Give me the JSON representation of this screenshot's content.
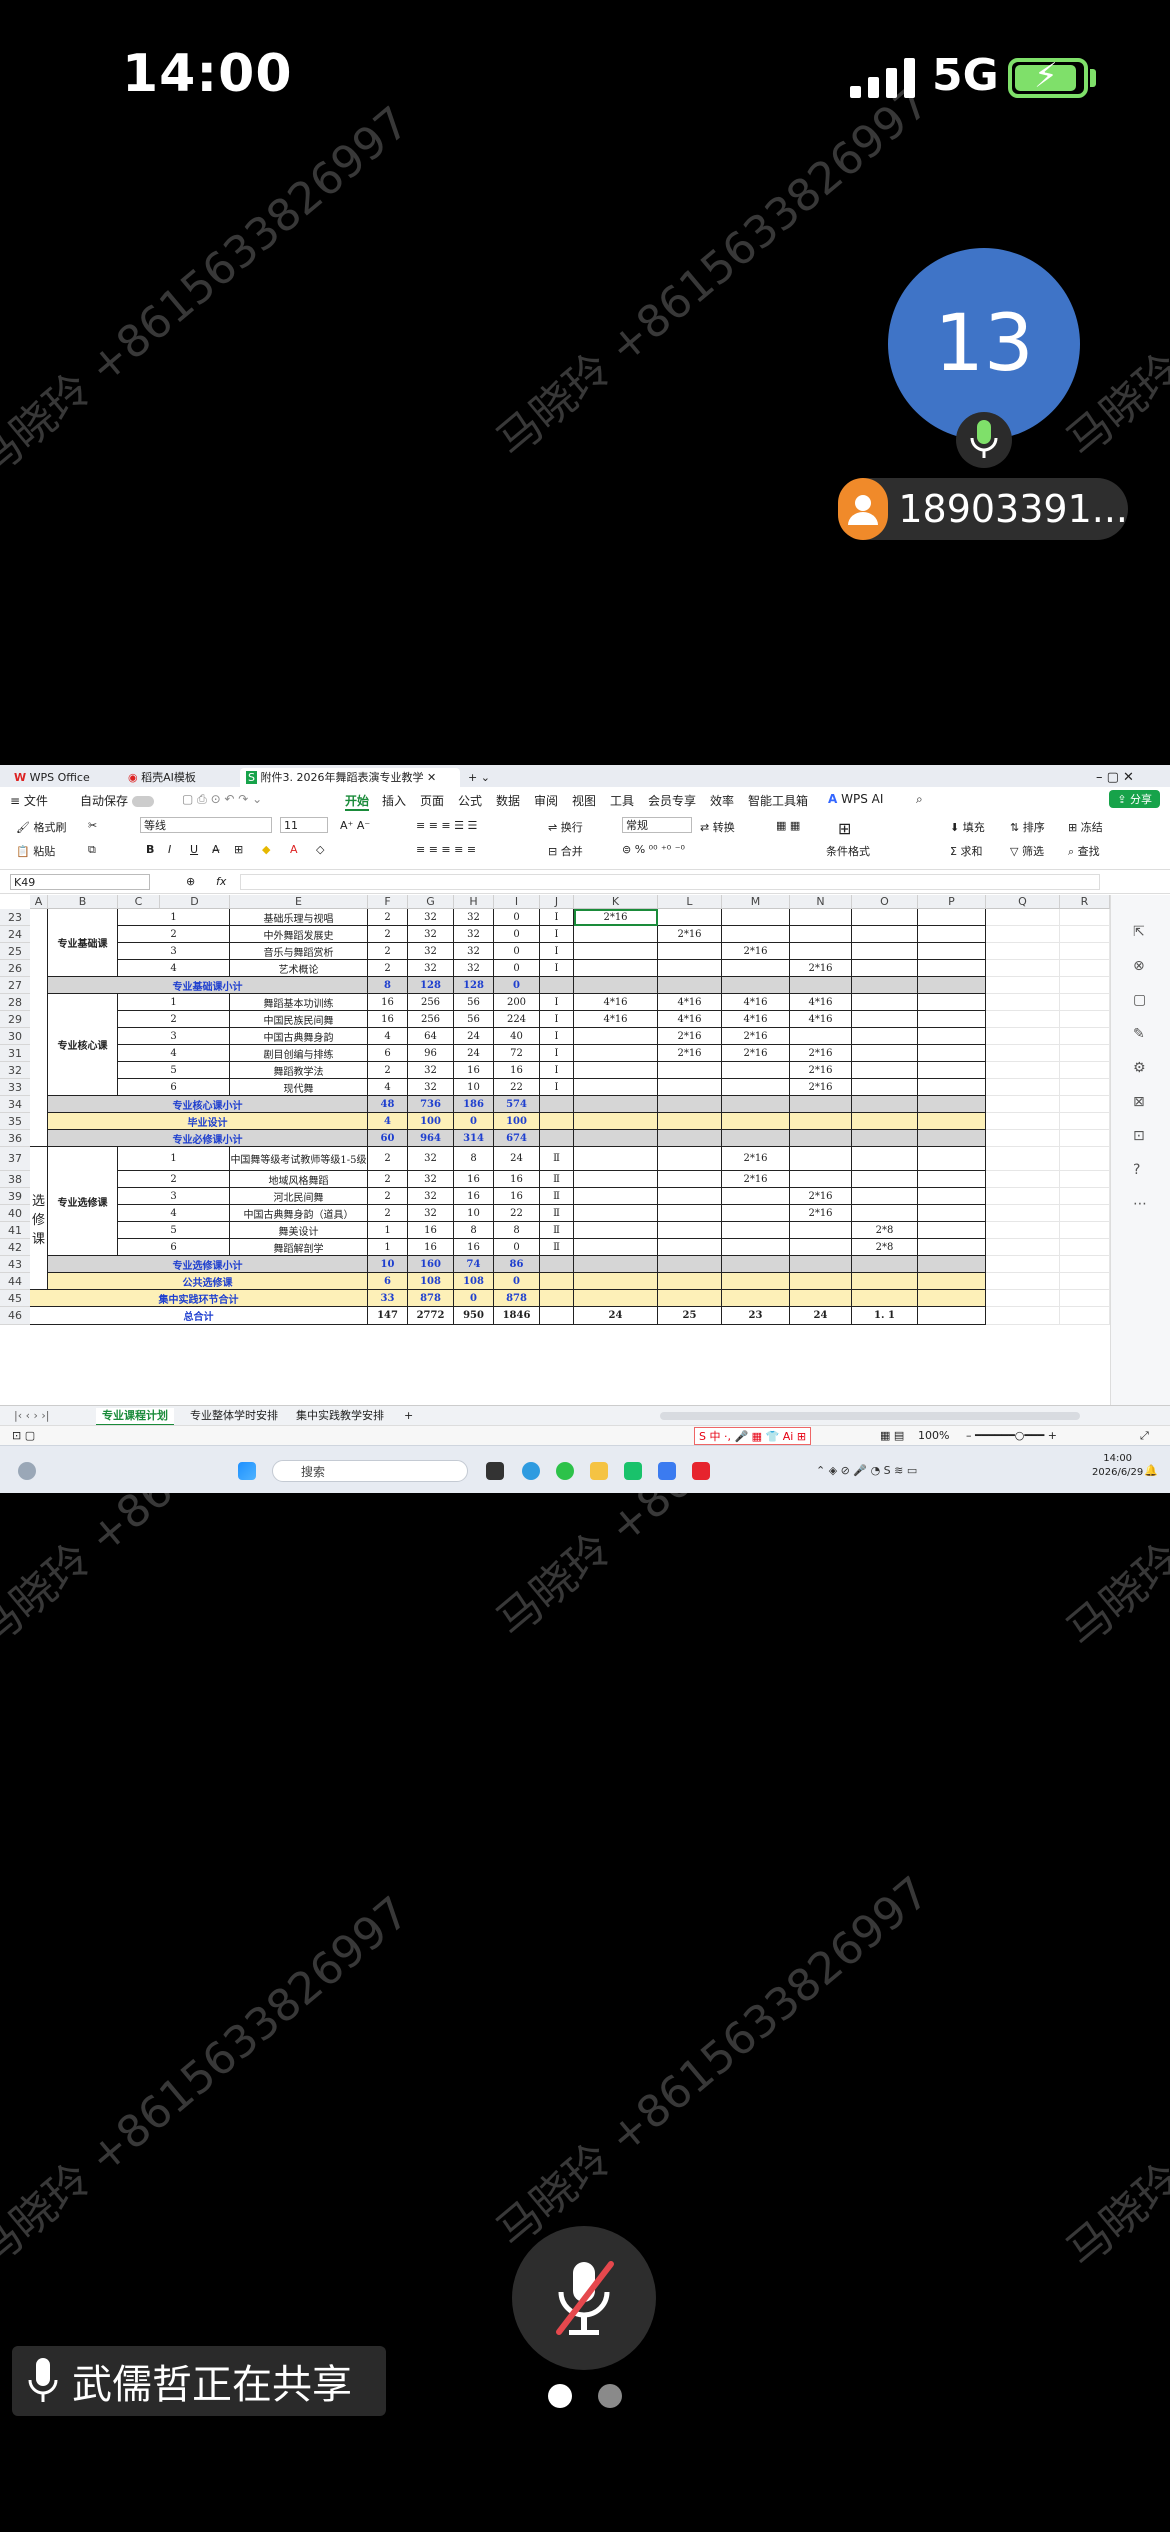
{
  "status_bar": {
    "time": "14:00",
    "network": "5G"
  },
  "participant": {
    "number": "13",
    "name": "18903391..."
  },
  "watermark": "马晓玲 +8615633826997",
  "share_notice": "武儒哲正在共享",
  "wps": {
    "tabs": [
      "WPS Office",
      "稻壳AI模板",
      "附件3. 2026年舞蹈表演专业教学"
    ],
    "menus": [
      "文件",
      "自动保存",
      "开始",
      "插入",
      "页面",
      "公式",
      "数据",
      "审阅",
      "视图",
      "工具",
      "会员专享",
      "效率",
      "智能工具箱"
    ],
    "wps_ai": "WPS AI",
    "share": "分享",
    "ribbon": {
      "format_painter": "格式刷",
      "paste": "粘贴",
      "font": "等线",
      "font_size": "11",
      "wrap": "换行",
      "merge": "合并",
      "number_format": "常规",
      "convert": "转换",
      "cond_format": "条件格式",
      "fill": "填充",
      "sort": "排序",
      "freeze": "冻结",
      "sum": "求和",
      "filter": "筛选",
      "find": "查找"
    },
    "name_box": "K49",
    "fx": "fx",
    "columns": [
      "A",
      "B",
      "C",
      "D",
      "E",
      "F",
      "G",
      "H",
      "I",
      "J",
      "K",
      "L",
      "M",
      "N",
      "O",
      "P",
      "Q",
      "R"
    ],
    "rows": [
      {
        "n": "23",
        "c": "1",
        "e": "基础乐理与视唱",
        "f": "2",
        "g": "32",
        "h": "32",
        "i": "0",
        "j": "Ⅰ",
        "k": "2*16",
        "l": "",
        "m": "",
        "nn": "",
        "o": ""
      },
      {
        "n": "24",
        "c": "2",
        "e": "中外舞蹈发展史",
        "f": "2",
        "g": "32",
        "h": "32",
        "i": "0",
        "j": "Ⅰ",
        "k": "",
        "l": "2*16",
        "m": "",
        "nn": "",
        "o": ""
      },
      {
        "n": "25",
        "c": "3",
        "e": "音乐与舞蹈赏析",
        "f": "2",
        "g": "32",
        "h": "32",
        "i": "0",
        "j": "Ⅰ",
        "k": "",
        "l": "",
        "m": "2*16",
        "nn": "",
        "o": ""
      },
      {
        "n": "26",
        "c": "4",
        "e": "艺术概论",
        "f": "2",
        "g": "32",
        "h": "32",
        "i": "0",
        "j": "Ⅰ",
        "k": "",
        "l": "",
        "m": "",
        "nn": "2*16",
        "o": ""
      },
      {
        "n": "28",
        "c": "1",
        "e": "舞蹈基本功训练",
        "f": "16",
        "g": "256",
        "h": "56",
        "i": "200",
        "j": "Ⅰ",
        "k": "4*16",
        "l": "4*16",
        "m": "4*16",
        "nn": "4*16",
        "o": ""
      },
      {
        "n": "29",
        "c": "2",
        "e": "中国民族民间舞",
        "f": "16",
        "g": "256",
        "h": "56",
        "i": "224",
        "j": "Ⅰ",
        "k": "4*16",
        "l": "4*16",
        "m": "4*16",
        "nn": "4*16",
        "o": ""
      },
      {
        "n": "30",
        "c": "3",
        "e": "中国古典舞身韵",
        "f": "4",
        "g": "64",
        "h": "24",
        "i": "40",
        "j": "Ⅰ",
        "k": "",
        "l": "2*16",
        "m": "2*16",
        "nn": "",
        "o": ""
      },
      {
        "n": "31",
        "c": "4",
        "e": "剧目创编与排练",
        "f": "6",
        "g": "96",
        "h": "24",
        "i": "72",
        "j": "Ⅰ",
        "k": "",
        "l": "2*16",
        "m": "2*16",
        "nn": "2*16",
        "o": ""
      },
      {
        "n": "32",
        "c": "5",
        "e": "舞蹈教学法",
        "f": "2",
        "g": "32",
        "h": "16",
        "i": "16",
        "j": "Ⅰ",
        "k": "",
        "l": "",
        "m": "",
        "nn": "2*16",
        "o": ""
      },
      {
        "n": "33",
        "c": "6",
        "e": "现代舞",
        "f": "4",
        "g": "32",
        "h": "10",
        "i": "22",
        "j": "Ⅰ",
        "k": "",
        "l": "",
        "m": "",
        "nn": "2*16",
        "o": ""
      },
      {
        "n": "37",
        "c": "1",
        "e": "中国舞等级考试教师等级1-5级",
        "f": "2",
        "g": "32",
        "h": "8",
        "i": "24",
        "j": "Ⅱ",
        "k": "",
        "l": "",
        "m": "2*16",
        "nn": "",
        "o": ""
      },
      {
        "n": "38",
        "c": "2",
        "e": "地域风格舞蹈",
        "f": "2",
        "g": "32",
        "h": "16",
        "i": "16",
        "j": "Ⅱ",
        "k": "",
        "l": "",
        "m": "2*16",
        "nn": "",
        "o": ""
      },
      {
        "n": "39",
        "c": "3",
        "e": "河北民间舞",
        "f": "2",
        "g": "32",
        "h": "16",
        "i": "16",
        "j": "Ⅱ",
        "k": "",
        "l": "",
        "m": "",
        "nn": "2*16",
        "o": ""
      },
      {
        "n": "40",
        "c": "4",
        "e": "中国古典舞身韵（道具）",
        "f": "2",
        "g": "32",
        "h": "10",
        "i": "22",
        "j": "Ⅱ",
        "k": "",
        "l": "",
        "m": "",
        "nn": "2*16",
        "o": ""
      },
      {
        "n": "41",
        "c": "5",
        "e": "舞美设计",
        "f": "1",
        "g": "16",
        "h": "8",
        "i": "8",
        "j": "Ⅱ",
        "k": "",
        "l": "",
        "m": "",
        "nn": "",
        "o": "2*8"
      },
      {
        "n": "42",
        "c": "6",
        "e": "舞蹈解剖学",
        "f": "1",
        "g": "16",
        "h": "16",
        "i": "0",
        "j": "Ⅱ",
        "k": "",
        "l": "",
        "m": "",
        "nn": "",
        "o": "2*8"
      }
    ],
    "subtotals": [
      {
        "n": "27",
        "label": "专业基础课小计",
        "f": "8",
        "g": "128",
        "h": "128",
        "i": "0"
      },
      {
        "n": "34",
        "label": "专业核心课小计",
        "f": "48",
        "g": "736",
        "h": "186",
        "i": "574"
      },
      {
        "n": "35",
        "label": "毕业设计",
        "f": "4",
        "g": "100",
        "h": "0",
        "i": "100"
      },
      {
        "n": "36",
        "label": "专业必修课小计",
        "f": "60",
        "g": "964",
        "h": "314",
        "i": "674"
      },
      {
        "n": "43",
        "label": "专业选修课小计",
        "f": "10",
        "g": "160",
        "h": "74",
        "i": "86"
      },
      {
        "n": "44",
        "label": "公共选修课",
        "f": "6",
        "g": "108",
        "h": "108",
        "i": "0"
      },
      {
        "n": "45",
        "label": "集中实践环节合计",
        "f": "33",
        "g": "878",
        "h": "0",
        "i": "878"
      }
    ],
    "total": {
      "n": "46",
      "label": "总合计",
      "f": "147",
      "g": "2772",
      "h": "950",
      "i": "1846",
      "k": "24",
      "l": "25",
      "m": "23",
      "nn": "24",
      "o": "1. 1"
    },
    "groups": {
      "basic": "专业基础课",
      "core": "专业核心课",
      "elective": "专业选修课",
      "xuanxiu": "选修课"
    },
    "sheet_tabs": [
      "专业课程计划",
      "专业整体学时安排",
      "集中实践教学安排"
    ],
    "zoom": "100%",
    "taskbar": {
      "search": "搜索",
      "time": "14:00",
      "date": "2026/6/29"
    }
  }
}
